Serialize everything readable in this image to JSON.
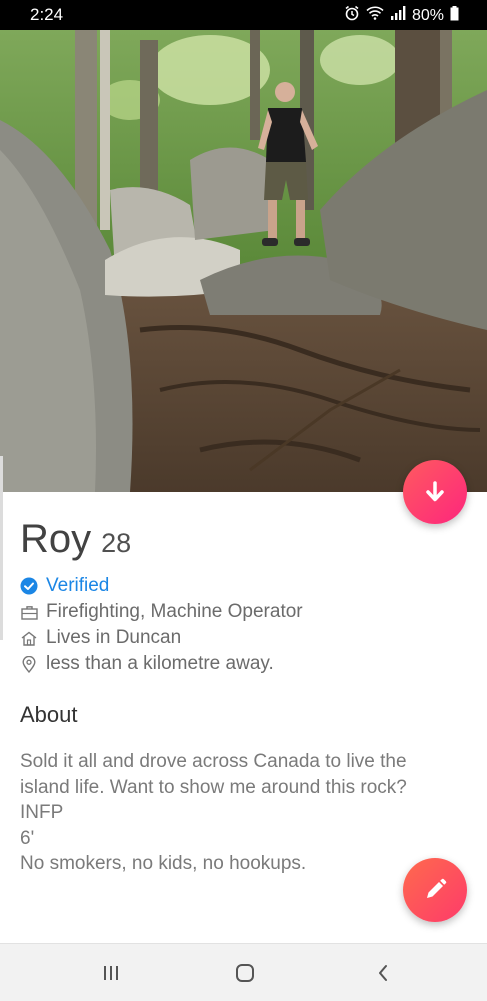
{
  "status_bar": {
    "time": "2:24",
    "battery": "80%",
    "icons": [
      "alarm-icon",
      "wifi-icon",
      "signal-icon",
      "battery-icon"
    ]
  },
  "profile": {
    "name": "Roy",
    "age": "28",
    "verified_label": "Verified",
    "job": "Firefighting, Machine Operator",
    "location": "Lives in Duncan",
    "distance": "less than a kilometre away."
  },
  "about": {
    "heading": "About",
    "bio_lines": [
      "Sold it all and drove across Canada to live the",
      "island life. Want to show me around this rock?",
      "INFP",
      "6'",
      "No smokers, no kids, no hookups."
    ]
  },
  "colors": {
    "accent_gradient_start": "#ff5a5f",
    "accent_gradient_end": "#fd267d",
    "verified_blue": "#1b86e5"
  },
  "buttons": {
    "collapse_icon": "arrow-down-icon",
    "edit_icon": "pencil-icon"
  },
  "nav": {
    "icons": [
      "recent-apps-icon",
      "home-icon",
      "back-icon"
    ]
  }
}
